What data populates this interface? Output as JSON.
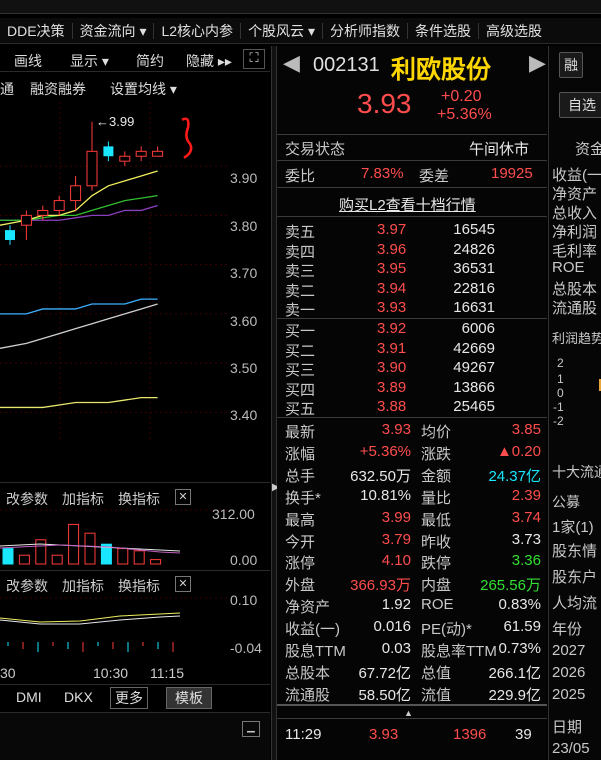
{
  "menu": {
    "items": [
      "DDE决策",
      "资金流向 ▾",
      "L2核心内参",
      "个股风云 ▾",
      "分析师指数",
      "条件选股",
      "高级选股"
    ]
  },
  "left": {
    "toolbar1": {
      "draw": "画线",
      "display": "显示 ▾",
      "simple": "简约",
      "hide": "隐藏 ▸▸"
    },
    "toolbar2": {
      "tong": "通",
      "margin": "融资融券",
      "ma_setting": "设置均线 ▾"
    },
    "high_label": "←3.99",
    "price_ticks": [
      "3.90",
      "3.80",
      "3.70",
      "3.60",
      "3.50",
      "3.40"
    ],
    "vol_toolbar": {
      "change": "改参数",
      "add": "加指标",
      "switch": "换指标"
    },
    "vol_ticks": [
      "312.00",
      "0.00"
    ],
    "ind_toolbar": {
      "change": "改参数",
      "add": "加指标",
      "switch": "换指标"
    },
    "ind_ticks": [
      "0.10",
      "-0.04"
    ],
    "time_labels": [
      "30",
      "10:30",
      "11:15"
    ],
    "bottom_tabs": {
      "dmi": "DMI",
      "dkx": "DKX",
      "more": "更多",
      "template": "模板"
    }
  },
  "chart_data": {
    "type": "candlestick",
    "ylim": [
      3.35,
      4.02
    ],
    "candles": [
      {
        "o": 3.75,
        "c": 3.77,
        "h": 3.78,
        "l": 3.74,
        "color": "cyan"
      },
      {
        "o": 3.78,
        "c": 3.8,
        "h": 3.81,
        "l": 3.75,
        "color": "red"
      },
      {
        "o": 3.81,
        "c": 3.8,
        "h": 3.82,
        "l": 3.79,
        "color": "red"
      },
      {
        "o": 3.81,
        "c": 3.83,
        "h": 3.84,
        "l": 3.8,
        "color": "red"
      },
      {
        "o": 3.83,
        "c": 3.86,
        "h": 3.88,
        "l": 3.81,
        "color": "red"
      },
      {
        "o": 3.86,
        "c": 3.93,
        "h": 3.99,
        "l": 3.85,
        "color": "red"
      },
      {
        "o": 3.94,
        "c": 3.92,
        "h": 3.95,
        "l": 3.91,
        "color": "cyan"
      },
      {
        "o": 3.91,
        "c": 3.92,
        "h": 3.93,
        "l": 3.9,
        "color": "red"
      },
      {
        "o": 3.92,
        "c": 3.93,
        "h": 3.94,
        "l": 3.91,
        "color": "red"
      },
      {
        "o": 3.92,
        "c": 3.93,
        "h": 3.94,
        "l": 3.92,
        "color": "red"
      }
    ],
    "ma_short": [
      3.78,
      3.79,
      3.8,
      3.8,
      3.81,
      3.84,
      3.86,
      3.87,
      3.88,
      3.89
    ],
    "ma_mid": [
      3.79,
      3.79,
      3.795,
      3.8,
      3.8,
      3.81,
      3.82,
      3.83,
      3.835,
      3.84
    ],
    "ma_long1": [
      3.79,
      3.79,
      3.79,
      3.79,
      3.795,
      3.8,
      3.8,
      3.81,
      3.81,
      3.82
    ],
    "ma_long2": [
      3.53,
      3.54,
      3.55,
      3.56,
      3.57,
      3.58,
      3.59,
      3.6,
      3.61,
      3.62
    ],
    "ma_long3": [
      3.6,
      3.6,
      3.61,
      3.61,
      3.61,
      3.62,
      3.62,
      3.62,
      3.63,
      3.63
    ],
    "ma_long4": [
      3.41,
      3.41,
      3.41,
      3.415,
      3.42,
      3.42,
      3.42,
      3.425,
      3.43,
      3.43
    ]
  },
  "stock": {
    "code": "002131",
    "name": "利欧股份",
    "price": "3.93",
    "change": "+0.20",
    "pct": "+5.36%",
    "btn_rong": "融",
    "btn_zixuan": "自选"
  },
  "status": {
    "label": "交易状态",
    "value": "午间休市"
  },
  "weibi": {
    "label": "委比",
    "value": "7.83%",
    "cha_label": "委差",
    "cha_value": "19925"
  },
  "buy_l2": "购买L2查看十档行情",
  "asks": [
    {
      "label": "卖五",
      "price": "3.97",
      "vol": "16545"
    },
    {
      "label": "卖四",
      "price": "3.96",
      "vol": "24826"
    },
    {
      "label": "卖三",
      "price": "3.95",
      "vol": "36531"
    },
    {
      "label": "卖二",
      "price": "3.94",
      "vol": "22816"
    },
    {
      "label": "卖一",
      "price": "3.93",
      "vol": "16631"
    }
  ],
  "bids": [
    {
      "label": "买一",
      "price": "3.92",
      "vol": "6006"
    },
    {
      "label": "买二",
      "price": "3.91",
      "vol": "42669"
    },
    {
      "label": "买三",
      "price": "3.90",
      "vol": "49267"
    },
    {
      "label": "买四",
      "price": "3.89",
      "vol": "13866"
    },
    {
      "label": "买五",
      "price": "3.88",
      "vol": "25465"
    }
  ],
  "stats": [
    {
      "l1": "最新",
      "v1": "3.93",
      "c1": "red",
      "l2": "均价",
      "v2": "3.85",
      "c2": "red"
    },
    {
      "l1": "涨幅",
      "v1": "+5.36%",
      "c1": "red",
      "l2": "涨跌",
      "v2": "▲0.20",
      "c2": "red"
    },
    {
      "l1": "总手",
      "v1": "632.50万",
      "c1": "wht",
      "l2": "金额",
      "v2": "24.37亿",
      "c2": "cyan"
    },
    {
      "l1": "换手*",
      "v1": "10.81%",
      "c1": "wht",
      "l2": "量比",
      "v2": "2.39",
      "c2": "red"
    },
    {
      "l1": "最高",
      "v1": "3.99",
      "c1": "red",
      "l2": "最低",
      "v2": "3.74",
      "c2": "red"
    },
    {
      "l1": "今开",
      "v1": "3.79",
      "c1": "red",
      "l2": "昨收",
      "v2": "3.73",
      "c2": "wht"
    },
    {
      "l1": "涨停",
      "v1": "4.10",
      "c1": "red",
      "l2": "跌停",
      "v2": "3.36",
      "c2": "grn"
    },
    {
      "l1": "外盘",
      "v1": "366.93万",
      "c1": "red",
      "l2": "内盘",
      "v2": "265.56万",
      "c2": "grn"
    },
    {
      "l1": "净资产",
      "v1": "1.92",
      "c1": "wht",
      "l2": "ROE",
      "v2": "0.83%",
      "c2": "wht"
    },
    {
      "l1": "收益(一)",
      "v1": "0.016",
      "c1": "wht",
      "l2": "PE(动)*",
      "v2": "61.59",
      "c2": "wht"
    },
    {
      "l1": "股息TTM",
      "v1": "0.03",
      "c1": "wht",
      "l2": "股息率TTM",
      "v2": "0.73%",
      "c2": "wht"
    },
    {
      "l1": "总股本",
      "v1": "67.72亿",
      "c1": "wht",
      "l2": "总值",
      "v2": "266.1亿",
      "c2": "wht"
    },
    {
      "l1": "流通股",
      "v1": "58.50亿",
      "c1": "wht",
      "l2": "流值",
      "v2": "229.9亿",
      "c2": "wht"
    }
  ],
  "tick": {
    "time": "11:29",
    "price": "3.93",
    "vol": "1396",
    "num": "39"
  },
  "far": {
    "tab": "资金",
    "items": [
      "收益(一",
      "净资产",
      "总收入",
      "净利润",
      "毛利率",
      "ROE",
      "总股本",
      "流通股"
    ],
    "profit_trend": "利润趋势",
    "axis": [
      "2",
      "1",
      "0",
      "-1",
      "-2"
    ],
    "top10": "十大流通",
    "gonggao": "公募",
    "jia": "1家(1)",
    "gudong": [
      "股东情",
      "股东户",
      "人均流"
    ],
    "years_label": "年份",
    "years": [
      "2027",
      "2026",
      "2025"
    ],
    "date_label": "日期",
    "date": "23/05"
  }
}
